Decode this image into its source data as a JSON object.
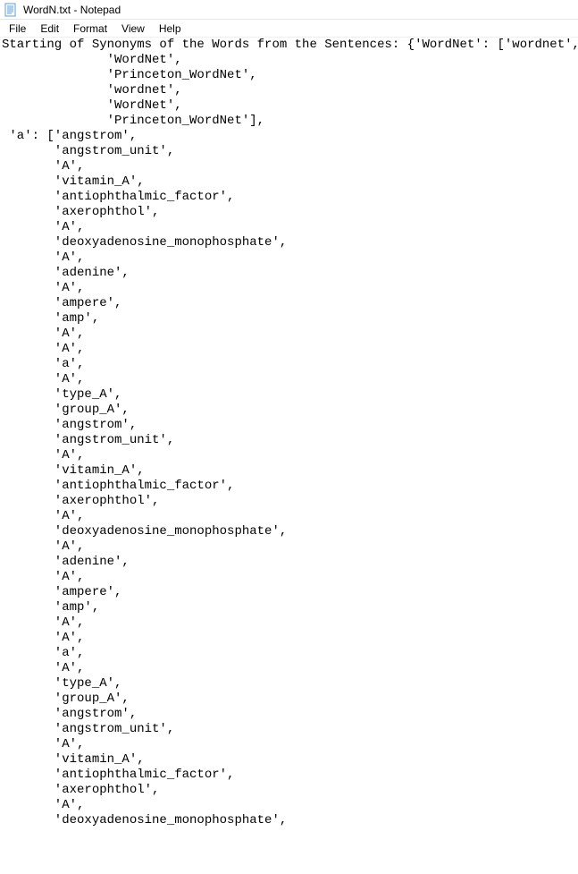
{
  "window": {
    "title": "WordN.txt - Notepad"
  },
  "menu": {
    "file": "File",
    "edit": "Edit",
    "format": "Format",
    "view": "View",
    "help": "Help"
  },
  "content_lines": [
    "Starting of Synonyms of the Words from the Sentences: {'WordNet': ['wordnet',",
    "              'WordNet',",
    "              'Princeton_WordNet',",
    "              'wordnet',",
    "              'WordNet',",
    "              'Princeton_WordNet'],",
    " 'a': ['angstrom',",
    "       'angstrom_unit',",
    "       'A',",
    "       'vitamin_A',",
    "       'antiophthalmic_factor',",
    "       'axerophthol',",
    "       'A',",
    "       'deoxyadenosine_monophosphate',",
    "       'A',",
    "       'adenine',",
    "       'A',",
    "       'ampere',",
    "       'amp',",
    "       'A',",
    "       'A',",
    "       'a',",
    "       'A',",
    "       'type_A',",
    "       'group_A',",
    "       'angstrom',",
    "       'angstrom_unit',",
    "       'A',",
    "       'vitamin_A',",
    "       'antiophthalmic_factor',",
    "       'axerophthol',",
    "       'A',",
    "       'deoxyadenosine_monophosphate',",
    "       'A',",
    "       'adenine',",
    "       'A',",
    "       'ampere',",
    "       'amp',",
    "       'A',",
    "       'A',",
    "       'a',",
    "       'A',",
    "       'type_A',",
    "       'group_A',",
    "       'angstrom',",
    "       'angstrom_unit',",
    "       'A',",
    "       'vitamin_A',",
    "       'antiophthalmic_factor',",
    "       'axerophthol',",
    "       'A',",
    "       'deoxyadenosine_monophosphate',"
  ]
}
